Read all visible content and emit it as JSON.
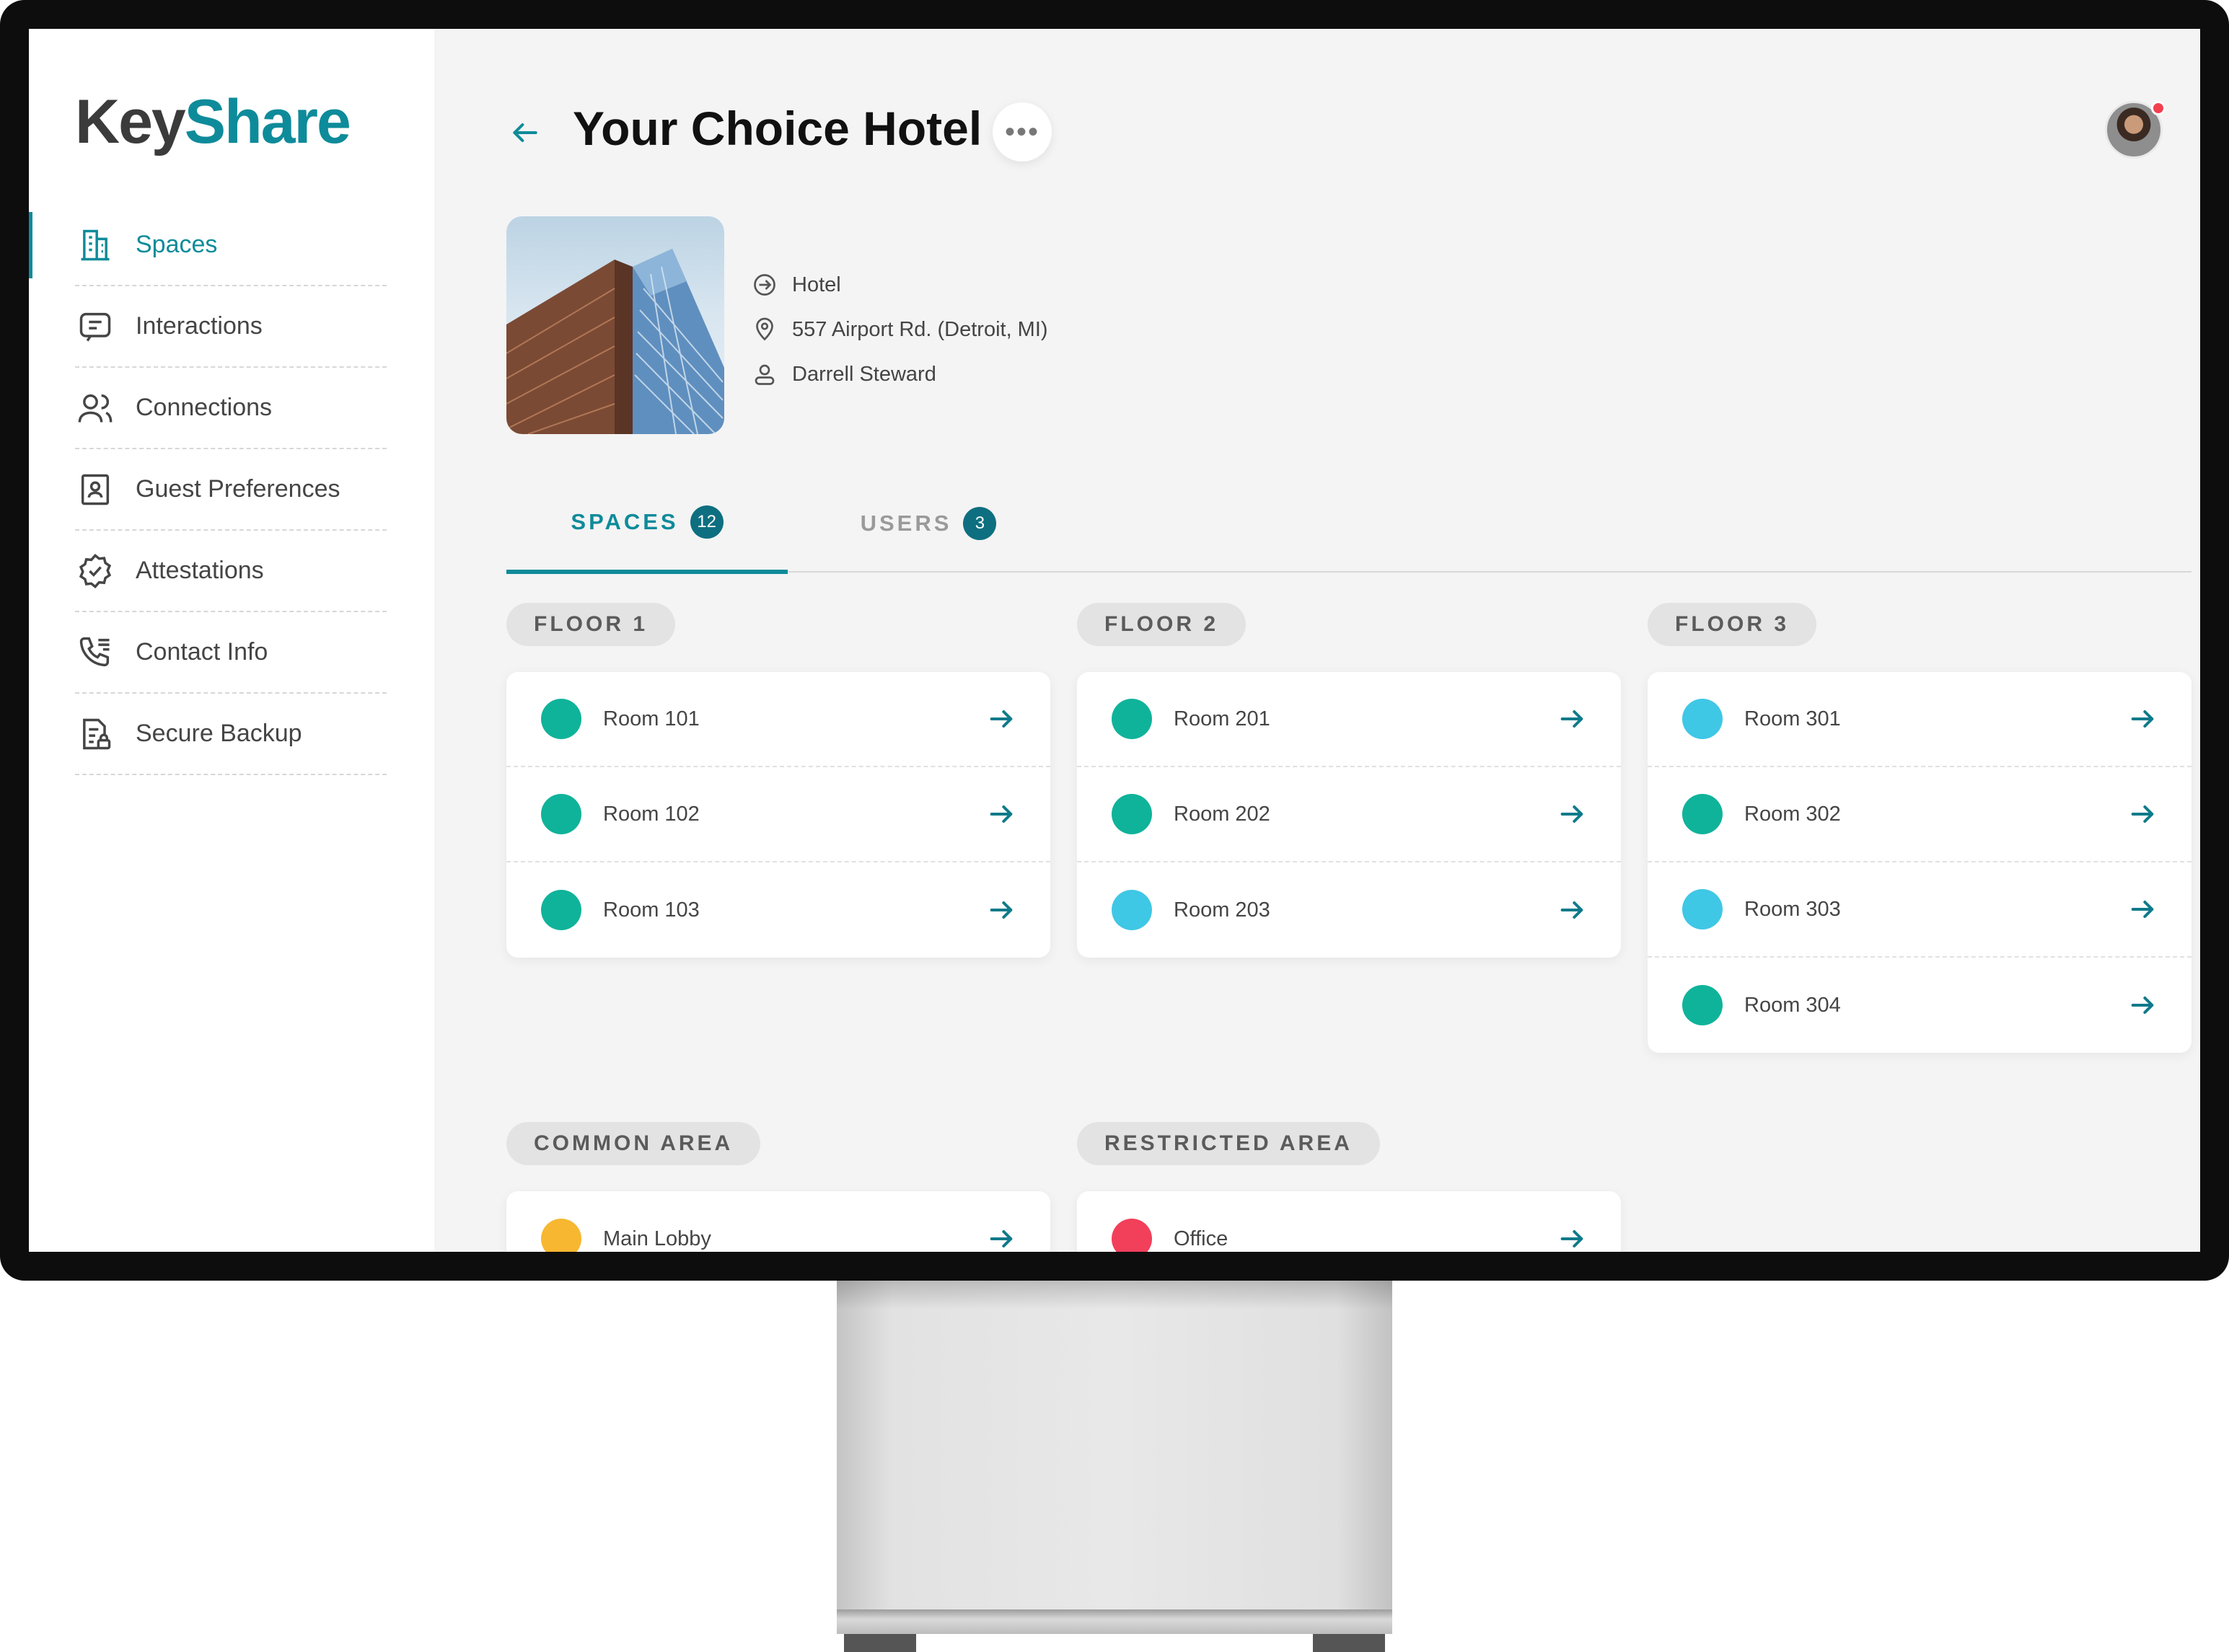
{
  "app": {
    "logo_part1": "Key",
    "logo_part2": "Share"
  },
  "sidebar": {
    "items": [
      {
        "label": "Spaces",
        "icon": "building-icon",
        "active": true
      },
      {
        "label": "Interactions",
        "icon": "message-icon",
        "active": false
      },
      {
        "label": "Connections",
        "icon": "users-icon",
        "active": false
      },
      {
        "label": "Guest Preferences",
        "icon": "id-badge-icon",
        "active": false
      },
      {
        "label": "Attestations",
        "icon": "verified-badge-icon",
        "active": false
      },
      {
        "label": "Contact Info",
        "icon": "phone-list-icon",
        "active": false
      },
      {
        "label": "Secure Backup",
        "icon": "document-lock-icon",
        "active": false
      }
    ]
  },
  "header": {
    "title": "Your Choice Hotel",
    "more_label": "•••"
  },
  "property": {
    "type": "Hotel",
    "address": "557 Airport Rd. (Detroit, MI)",
    "owner": "Darrell Steward"
  },
  "tabs": [
    {
      "label": "SPACES",
      "count": "12",
      "active": true
    },
    {
      "label": "USERS",
      "count": "3",
      "active": false
    }
  ],
  "colors": {
    "accent": "#0e8b9a",
    "status_green": "#0fb39a",
    "status_blue": "#3fc7e6",
    "status_yellow": "#f7b731",
    "status_red": "#f23f5a"
  },
  "sections": [
    {
      "label": "FLOOR 1",
      "rooms": [
        {
          "name": "Room 101",
          "status": "green"
        },
        {
          "name": "Room 102",
          "status": "green"
        },
        {
          "name": "Room 103",
          "status": "green"
        }
      ]
    },
    {
      "label": "FLOOR 2",
      "rooms": [
        {
          "name": "Room 201",
          "status": "green"
        },
        {
          "name": "Room 202",
          "status": "green"
        },
        {
          "name": "Room 203",
          "status": "blue"
        }
      ]
    },
    {
      "label": "FLOOR 3",
      "rooms": [
        {
          "name": "Room 301",
          "status": "blue"
        },
        {
          "name": "Room 302",
          "status": "green"
        },
        {
          "name": "Room 303",
          "status": "blue"
        },
        {
          "name": "Room 304",
          "status": "green"
        }
      ]
    },
    {
      "label": "COMMON AREA",
      "rooms": [
        {
          "name": "Main Lobby",
          "status": "yellow"
        }
      ]
    },
    {
      "label": "RESTRICTED AREA",
      "rooms": [
        {
          "name": "Office",
          "status": "red"
        }
      ]
    }
  ]
}
